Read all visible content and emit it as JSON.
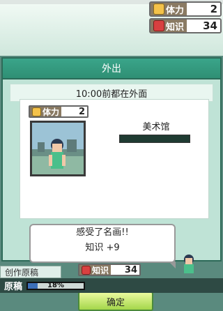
{
  "hud": {
    "stamina": {
      "icon": "stamina-icon",
      "label": "体力",
      "value": "2"
    },
    "knowledge": {
      "icon": "knowledge-icon",
      "label": "知识",
      "value": "34"
    }
  },
  "dialog": {
    "title": "外出",
    "subtitle": "10:00前都在外面",
    "stamina": {
      "label": "体力",
      "value": "2"
    },
    "place": "美术馆",
    "message_line1": "感受了名画!!",
    "message_line2": "知识 +9",
    "knowledge_result": {
      "label": "知识",
      "value": "34"
    },
    "confirm_label": "确定"
  },
  "bottom": {
    "tab_label": "创作原稿",
    "manuscript_label": "原稿",
    "progress_text": "18%",
    "progress_value": 0.18
  },
  "colors": {
    "dialog_header": "#3aa58a",
    "button_green": "#a4d64a",
    "progress_blue": "#3c6fb8"
  }
}
